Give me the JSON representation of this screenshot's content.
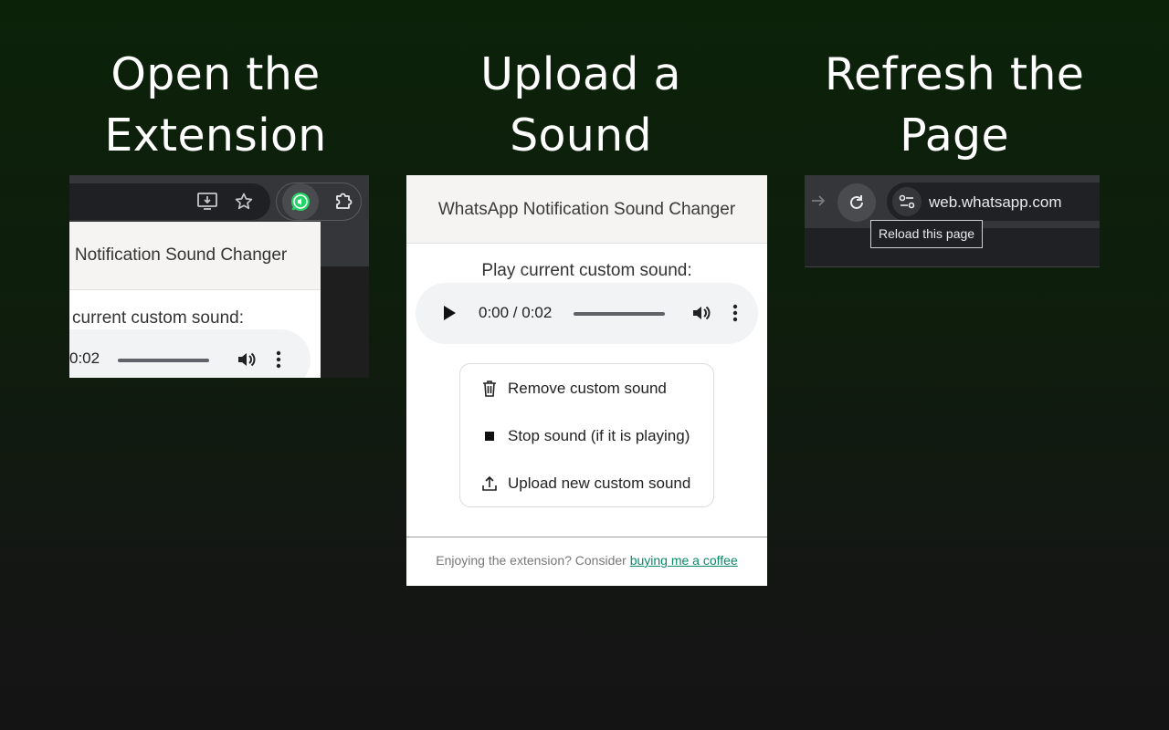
{
  "steps": [
    {
      "title_line1": "Open the",
      "title_line2": "Extension"
    },
    {
      "title_line1": "Upload a",
      "title_line2": "Sound"
    },
    {
      "title_line1": "Refresh the",
      "title_line2": "Page"
    }
  ],
  "panel1": {
    "popup_title_fragment": "p Notification Sound Changer",
    "label_fragment": "current custom sound:",
    "time_fragment": "0:02",
    "colors": {
      "ext_icon": "#25d366"
    }
  },
  "popup": {
    "title": "WhatsApp Notification Sound Changer",
    "play_label": "Play current custom sound:",
    "player_time": "0:00 / 0:02",
    "actions": [
      {
        "icon": "trash-icon",
        "label": "Remove custom sound"
      },
      {
        "icon": "stop-icon",
        "label": "Stop sound (if it is playing)"
      },
      {
        "icon": "upload-icon",
        "label": "Upload new custom sound"
      }
    ],
    "footer_text": "Enjoying the extension? Consider ",
    "footer_link": "buying me a coffee",
    "colors": {
      "link": "#0b8a6a",
      "header_bg": "#f5f4f2"
    }
  },
  "panel3": {
    "url": "web.whatsapp.com",
    "tooltip": "Reload this page"
  }
}
